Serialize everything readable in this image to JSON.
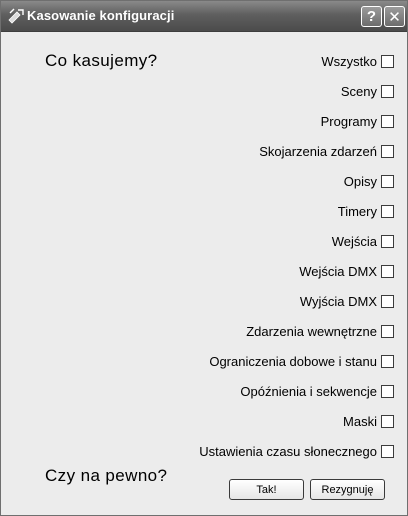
{
  "window": {
    "title": "Kasowanie konfiguracji",
    "help_glyph": "?",
    "close_glyph": "✕"
  },
  "question": "Co kasujemy?",
  "options": [
    {
      "label": "Wszystko",
      "checked": false
    },
    {
      "label": "Sceny",
      "checked": false
    },
    {
      "label": "Programy",
      "checked": false
    },
    {
      "label": "Skojarzenia zdarzeń",
      "checked": false
    },
    {
      "label": "Opisy",
      "checked": false
    },
    {
      "label": "Timery",
      "checked": false
    },
    {
      "label": "Wejścia",
      "checked": false
    },
    {
      "label": "Wejścia DMX",
      "checked": false
    },
    {
      "label": "Wyjścia DMX",
      "checked": false
    },
    {
      "label": "Zdarzenia wewnętrzne",
      "checked": false
    },
    {
      "label": "Ograniczenia dobowe i stanu",
      "checked": false
    },
    {
      "label": "Opóźnienia i sekwencje",
      "checked": false
    },
    {
      "label": "Maski",
      "checked": false
    },
    {
      "label": "Ustawienia czasu słonecznego",
      "checked": false
    }
  ],
  "confirm": "Czy na pewno?",
  "buttons": {
    "ok": "Tak!",
    "cancel": "Rezygnuję"
  }
}
